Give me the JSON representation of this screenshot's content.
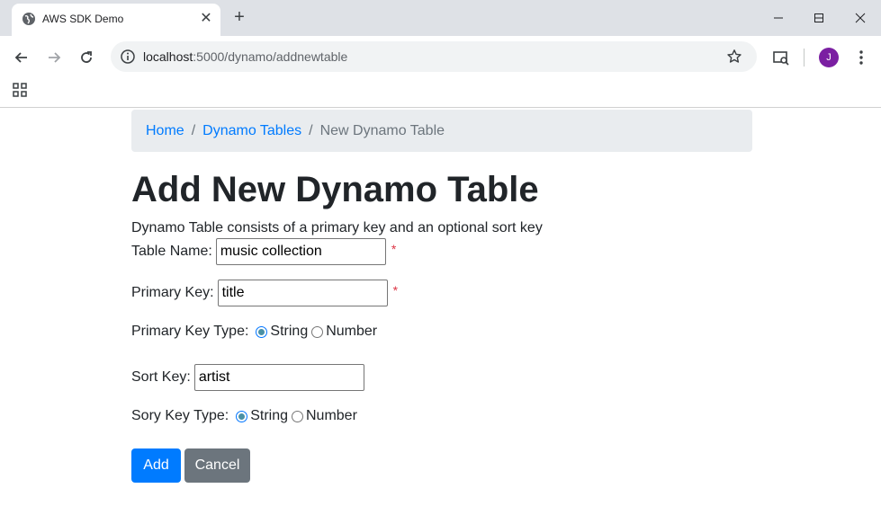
{
  "browser": {
    "tab_title": "AWS SDK Demo",
    "url_host": "localhost",
    "url_path": ":5000/dynamo/addnewtable",
    "profile_initial": "J"
  },
  "breadcrumb": {
    "home": "Home",
    "tables": "Dynamo Tables",
    "current": "New Dynamo Table",
    "separator": "/"
  },
  "page": {
    "title": "Add New Dynamo Table",
    "subtitle": "Dynamo Table consists of a primary key and an optional sort key"
  },
  "form": {
    "table_name_label": "Table Name:",
    "table_name_value": "music collection",
    "primary_key_label": "Primary Key:",
    "primary_key_value": "title",
    "primary_key_type_label": "Primary Key Type:",
    "sort_key_label": "Sort Key:",
    "sort_key_value": "artist",
    "sort_key_type_label": "Sory Key Type:",
    "type_string": "String",
    "type_number": "Number",
    "required_marker": "*",
    "primary_key_type_selected": "String",
    "sort_key_type_selected": "String"
  },
  "buttons": {
    "add": "Add",
    "cancel": "Cancel"
  },
  "colors": {
    "primary": "#007bff",
    "secondary": "#6c757d",
    "required": "#dc3545",
    "avatar": "#7b1fa2"
  }
}
